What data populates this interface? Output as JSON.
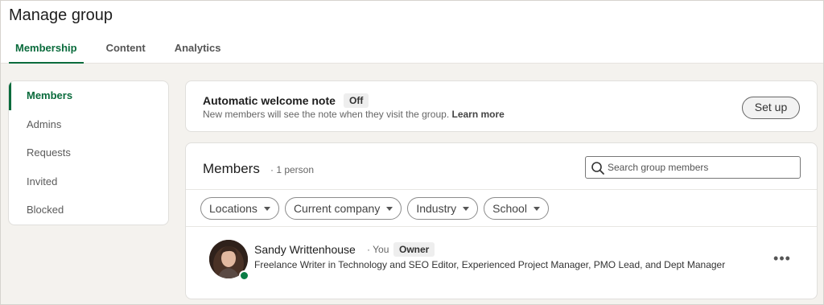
{
  "header": {
    "title": "Manage group",
    "tabs": [
      {
        "label": "Membership"
      },
      {
        "label": "Content"
      },
      {
        "label": "Analytics"
      }
    ]
  },
  "sidebar": {
    "items": [
      {
        "label": "Members"
      },
      {
        "label": "Admins"
      },
      {
        "label": "Requests"
      },
      {
        "label": "Invited"
      },
      {
        "label": "Blocked"
      }
    ]
  },
  "welcome": {
    "title": "Automatic welcome note",
    "status": "Off",
    "description": "New members will see the note when they visit the group.",
    "learn_more": "Learn more",
    "setup_label": "Set up"
  },
  "members": {
    "title": "Members",
    "count": "· 1 person",
    "search_placeholder": "Search group members",
    "filters": [
      {
        "label": "Locations"
      },
      {
        "label": "Current company"
      },
      {
        "label": "Industry"
      },
      {
        "label": "School"
      }
    ],
    "list": [
      {
        "name": "Sandy Writtenhouse",
        "you": "· You",
        "role": "Owner",
        "headline": "Freelance Writer in Technology and SEO Editor, Experienced Project Manager, PMO Lead, and Dept Manager",
        "more": "•••"
      }
    ]
  },
  "colors": {
    "accent": "#0a6b3c",
    "presence": "#0a7d45",
    "background": "#f4f2ee"
  }
}
